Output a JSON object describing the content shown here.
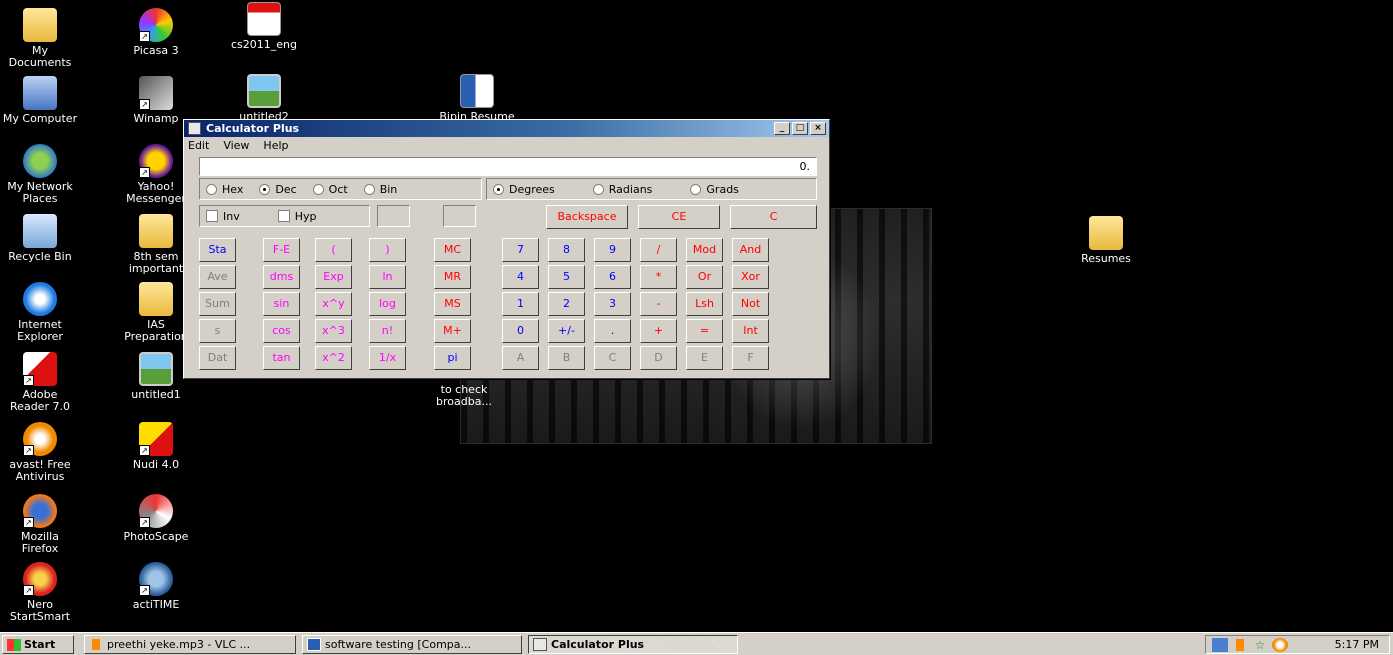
{
  "desktop": {
    "icons": [
      {
        "label": "My Documents",
        "icon": "folder-icon"
      },
      {
        "label": "Picasa 3",
        "icon": "picasa-icon"
      },
      {
        "label": "cs2011_eng",
        "icon": "pdf-icon"
      },
      {
        "label": "My Computer",
        "icon": "computer-icon"
      },
      {
        "label": "Winamp",
        "icon": "winamp-icon"
      },
      {
        "label": "untitled2",
        "icon": "image-icon"
      },
      {
        "label": "Bipin Resume",
        "icon": "word-doc-icon"
      },
      {
        "label": "My Network Places",
        "icon": "network-icon"
      },
      {
        "label": "Yahoo! Messenger",
        "icon": "yahoo-icon"
      },
      {
        "label": "Recycle Bin",
        "icon": "recycle-bin-icon"
      },
      {
        "label": "8th sem important",
        "icon": "folder-icon"
      },
      {
        "label": "Resumes",
        "icon": "folder-icon"
      },
      {
        "label": "Internet Explorer",
        "icon": "ie-icon"
      },
      {
        "label": "IAS Preparation",
        "icon": "folder-icon"
      },
      {
        "label": "Adobe Reader 7.0",
        "icon": "adobe-icon"
      },
      {
        "label": "untitled1",
        "icon": "image-icon"
      },
      {
        "label": "to check broadba...",
        "icon": "file-icon"
      },
      {
        "label": "avast! Free Antivirus",
        "icon": "avast-icon"
      },
      {
        "label": "Nudi 4.0",
        "icon": "nudi-icon"
      },
      {
        "label": "Mozilla Firefox",
        "icon": "firefox-icon"
      },
      {
        "label": "PhotoScape",
        "icon": "photoscape-icon"
      },
      {
        "label": "Nero StartSmart",
        "icon": "nero-icon"
      },
      {
        "label": "actiTIME",
        "icon": "actitime-icon"
      }
    ]
  },
  "calculator": {
    "title": "Calculator Plus",
    "window_buttons": {
      "minimize": "_",
      "maximize": "□",
      "close": "×"
    },
    "menu": [
      "Edit",
      "View",
      "Help"
    ],
    "display_value": "0.",
    "number_system": [
      "Hex",
      "Dec",
      "Oct",
      "Bin"
    ],
    "number_system_selected": "Dec",
    "angle_units": [
      "Degrees",
      "Radians",
      "Grads"
    ],
    "angle_selected": "Degrees",
    "inv_label": "Inv",
    "hyp_label": "Hyp",
    "backspace": "Backspace",
    "ce": "CE",
    "c": "C",
    "buttons": {
      "sta": "Sta",
      "ave": "Ave",
      "sum": "Sum",
      "s": "s",
      "dat": "Dat",
      "fe": "F-E",
      "dms": "dms",
      "sin": "sin",
      "cos": "cos",
      "tan": "tan",
      "lparen": "(",
      "exp": "Exp",
      "xy": "x^y",
      "x3": "x^3",
      "x2": "x^2",
      "rparen": ")",
      "ln": "ln",
      "log": "log",
      "nfact": "n!",
      "recip": "1/x",
      "mc": "MC",
      "mr": "MR",
      "ms": "MS",
      "mplus": "M+",
      "pi": "pi",
      "n7": "7",
      "n8": "8",
      "n9": "9",
      "div": "/",
      "mod": "Mod",
      "and": "And",
      "n4": "4",
      "n5": "5",
      "n6": "6",
      "mul": "*",
      "or": "Or",
      "xor": "Xor",
      "n1": "1",
      "n2": "2",
      "n3": "3",
      "sub": "-",
      "lsh": "Lsh",
      "not": "Not",
      "n0": "0",
      "pm": "+/-",
      "dot": ".",
      "add": "+",
      "eq": "=",
      "int": "Int",
      "ha": "A",
      "hb": "B",
      "hc": "C",
      "hd": "D",
      "he": "E",
      "hf": "F"
    }
  },
  "taskbar": {
    "start_label": "Start",
    "tasks": [
      {
        "label": "preethi yeke.mp3 - VLC ...",
        "icon": "vlc-icon"
      },
      {
        "label": "software testing [Compa...",
        "icon": "word-doc-icon"
      },
      {
        "label": "Calculator Plus",
        "icon": "calculator-icon"
      }
    ],
    "clock": "5:17 PM"
  },
  "colors": {
    "digits": "#0000ff",
    "operators": "#ff0000",
    "functions": "#ff00ff",
    "disabled": "#808080"
  }
}
